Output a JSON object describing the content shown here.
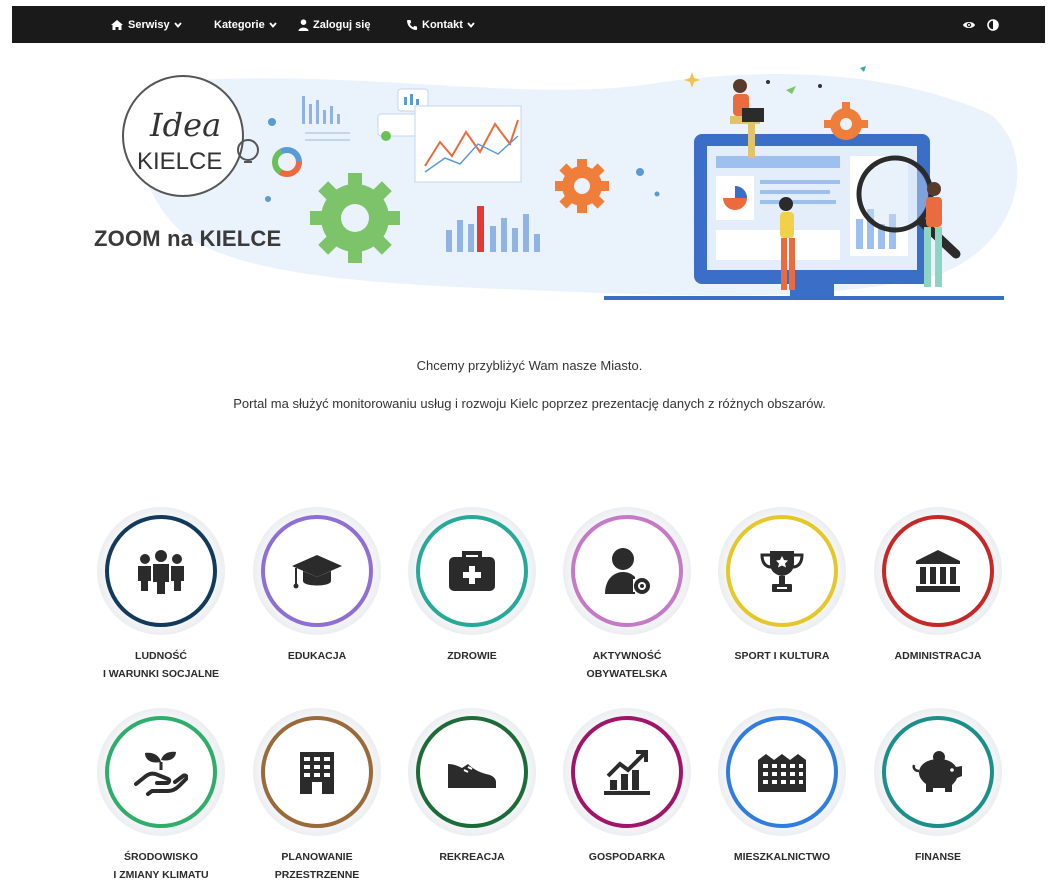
{
  "nav": {
    "serwisy": "Serwisy",
    "kategorie": "Kategorie",
    "zaloguj": "Zaloguj się",
    "kontakt": "Kontakt"
  },
  "logo": {
    "line1": "Idea",
    "line2": "KIELCE"
  },
  "hero_title": "ZOOM na KIELCE",
  "intro": {
    "line1": "Chcemy przybliżyć Wam nasze Miasto.",
    "line2": "Portal ma służyć monitorowaniu usług i rozwoju Kielc poprzez prezentację danych z różnych obszarów."
  },
  "categories": [
    {
      "label": "LUDNOŚĆ\nI WARUNKI SOCJALNE",
      "color": "#123a5c",
      "icon": "people-icon"
    },
    {
      "label": "EDUKACJA",
      "color": "#8f6fd6",
      "icon": "graduation-cap-icon"
    },
    {
      "label": "ZDROWIE",
      "color": "#27a99a",
      "icon": "medical-kit-icon"
    },
    {
      "label": "AKTYWNOŚĆ\nOBYWATELSKA",
      "color": "#c57ac7",
      "icon": "user-gear-icon"
    },
    {
      "label": "SPORT I KULTURA",
      "color": "#e6c72a",
      "icon": "trophy-icon"
    },
    {
      "label": "ADMINISTRACJA",
      "color": "#c62828",
      "icon": "institution-icon"
    },
    {
      "label": "ŚRODOWISKO\nI ZMIANY KLIMATU",
      "color": "#2fae6b",
      "icon": "plant-hand-icon"
    },
    {
      "label": "PLANOWANIE\nPRZESTRZENNE",
      "color": "#9a6a3a",
      "icon": "building-icon"
    },
    {
      "label": "REKREACJA",
      "color": "#1e6b3a",
      "icon": "sneaker-icon"
    },
    {
      "label": "GOSPODARKA",
      "color": "#a0156a",
      "icon": "growth-chart-icon"
    },
    {
      "label": "MIESZKALNICTWO",
      "color": "#2f7de1",
      "icon": "housing-icon"
    },
    {
      "label": "FINANSE",
      "color": "#1b8f8a",
      "icon": "piggy-bank-icon"
    }
  ]
}
